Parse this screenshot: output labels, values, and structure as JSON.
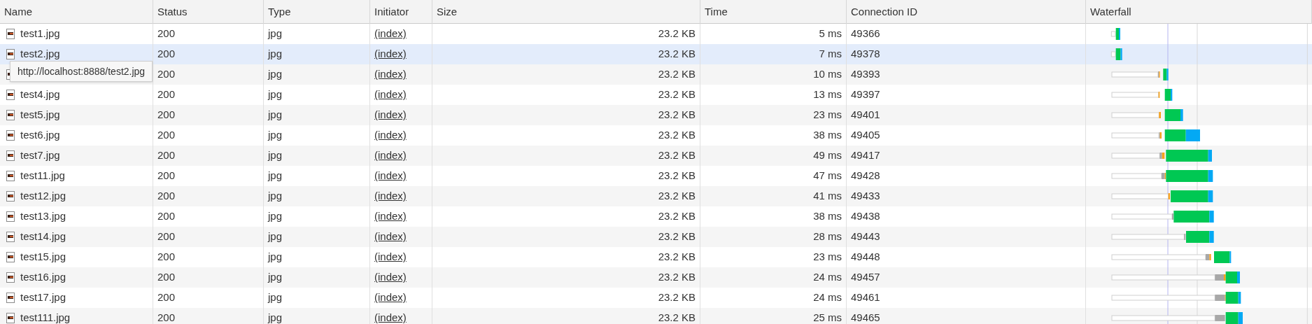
{
  "columns": [
    "Name",
    "Status",
    "Type",
    "Initiator",
    "Size",
    "Time",
    "Connection ID",
    "Waterfall"
  ],
  "rows": [
    {
      "name": "test1.jpg",
      "status": "200",
      "type": "jpg",
      "initiator": "(index)",
      "size": "23.2 KB",
      "time": "5 ms",
      "connection_id": "49366",
      "hovered": false
    },
    {
      "name": "test2.jpg",
      "status": "200",
      "type": "jpg",
      "initiator": "(index)",
      "size": "23.2 KB",
      "time": "7 ms",
      "connection_id": "49378",
      "hovered": true
    },
    {
      "status": "200",
      "type": "jpg",
      "initiator": "(index)",
      "size": "23.2 KB",
      "time": "10 ms",
      "connection_id": "49393",
      "hovered": false
    },
    {
      "name": "test4.jpg",
      "status": "200",
      "type": "jpg",
      "initiator": "(index)",
      "size": "23.2 KB",
      "time": "13 ms",
      "connection_id": "49397",
      "hovered": false
    },
    {
      "name": "test5.jpg",
      "status": "200",
      "type": "jpg",
      "initiator": "(index)",
      "size": "23.2 KB",
      "time": "23 ms",
      "connection_id": "49401",
      "hovered": false
    },
    {
      "name": "test6.jpg",
      "status": "200",
      "type": "jpg",
      "initiator": "(index)",
      "size": "23.2 KB",
      "time": "38 ms",
      "connection_id": "49405",
      "hovered": false
    },
    {
      "name": "test7.jpg",
      "status": "200",
      "type": "jpg",
      "initiator": "(index)",
      "size": "23.2 KB",
      "time": "49 ms",
      "connection_id": "49417",
      "hovered": false
    },
    {
      "name": "test11.jpg",
      "status": "200",
      "type": "jpg",
      "initiator": "(index)",
      "size": "23.2 KB",
      "time": "47 ms",
      "connection_id": "49428",
      "hovered": false
    },
    {
      "name": "test12.jpg",
      "status": "200",
      "type": "jpg",
      "initiator": "(index)",
      "size": "23.2 KB",
      "time": "41 ms",
      "connection_id": "49433",
      "hovered": false
    },
    {
      "name": "test13.jpg",
      "status": "200",
      "type": "jpg",
      "initiator": "(index)",
      "size": "23.2 KB",
      "time": "38 ms",
      "connection_id": "49438",
      "hovered": false
    },
    {
      "name": "test14.jpg",
      "status": "200",
      "type": "jpg",
      "initiator": "(index)",
      "size": "23.2 KB",
      "time": "28 ms",
      "connection_id": "49443",
      "hovered": false
    },
    {
      "name": "test15.jpg",
      "status": "200",
      "type": "jpg",
      "initiator": "(index)",
      "size": "23.2 KB",
      "time": "23 ms",
      "connection_id": "49448",
      "hovered": false
    },
    {
      "name": "test16.jpg",
      "status": "200",
      "type": "jpg",
      "initiator": "(index)",
      "size": "23.2 KB",
      "time": "24 ms",
      "connection_id": "49457",
      "hovered": false
    },
    {
      "name": "test17.jpg",
      "status": "200",
      "type": "jpg",
      "initiator": "(index)",
      "size": "23.2 KB",
      "time": "24 ms",
      "connection_id": "49461",
      "hovered": false
    },
    {
      "name": "test111.jpg",
      "status": "200",
      "type": "jpg",
      "initiator": "(index)",
      "size": "23.2 KB",
      "time": "25 ms",
      "connection_id": "49465",
      "hovered": false
    }
  ],
  "tooltip": {
    "text": "http://localhost:8888/test2.jpg"
  }
}
